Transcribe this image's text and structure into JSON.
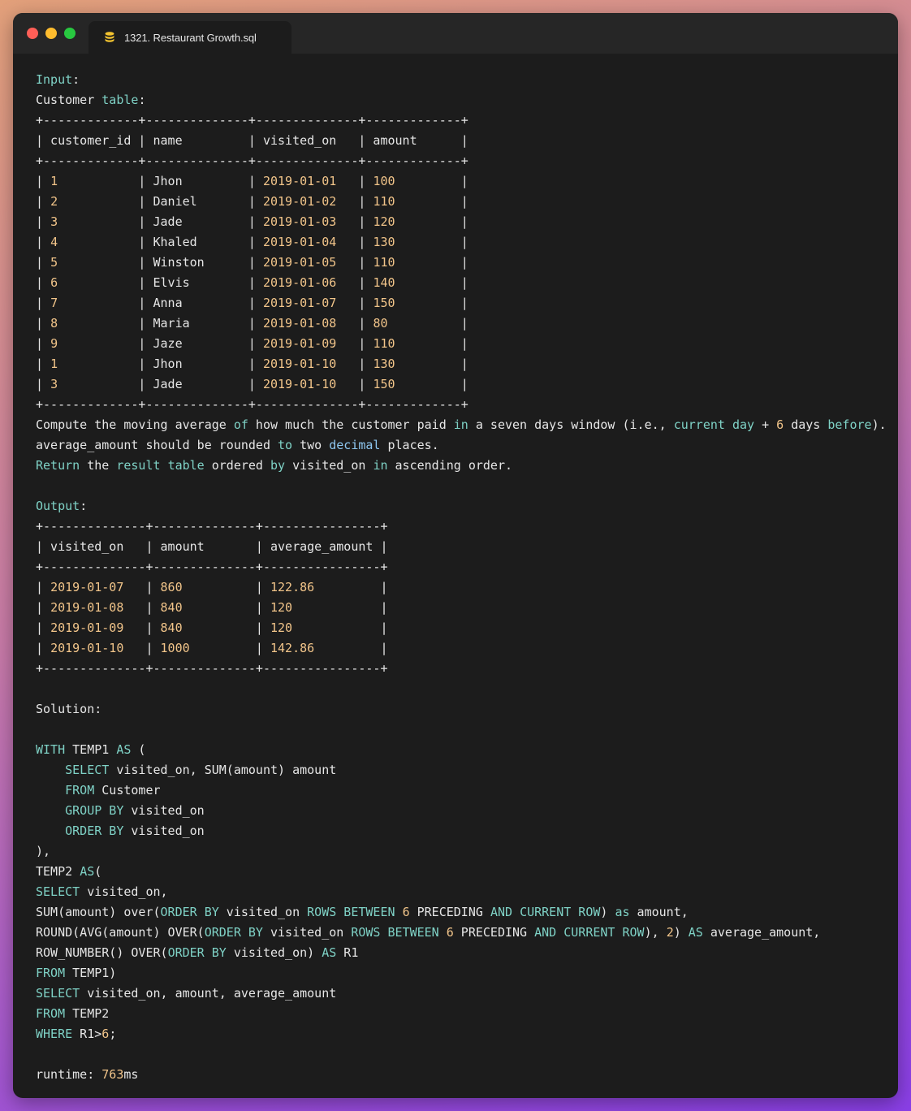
{
  "window": {
    "tab_title": "1321. Restaurant Growth.sql",
    "tab_icon": "database-icon",
    "colors": {
      "keyword": "#7fd2c6",
      "number": "#f2c58a",
      "text": "#e6e6e6",
      "background": "#1c1c1c"
    }
  },
  "editor": {
    "lines": [
      [
        {
          "t": "Input",
          "c": "kw"
        },
        {
          "t": ":"
        }
      ],
      [
        {
          "t": "Customer "
        },
        {
          "t": "table",
          "c": "kw"
        },
        {
          "t": ":"
        }
      ],
      [
        {
          "t": "+-------------+--------------+--------------+-------------+"
        }
      ],
      [
        {
          "t": "| customer_id | name         | visited_on   | amount      |"
        }
      ],
      [
        {
          "t": "+-------------+--------------+--------------+-------------+"
        }
      ],
      [
        {
          "t": "| "
        },
        {
          "t": "1",
          "c": "num"
        },
        {
          "t": "           | Jhon         | "
        },
        {
          "t": "2019-01-01",
          "c": "num"
        },
        {
          "t": "   | "
        },
        {
          "t": "100",
          "c": "num"
        },
        {
          "t": "         |"
        }
      ],
      [
        {
          "t": "| "
        },
        {
          "t": "2",
          "c": "num"
        },
        {
          "t": "           | Daniel       | "
        },
        {
          "t": "2019-01-02",
          "c": "num"
        },
        {
          "t": "   | "
        },
        {
          "t": "110",
          "c": "num"
        },
        {
          "t": "         |"
        }
      ],
      [
        {
          "t": "| "
        },
        {
          "t": "3",
          "c": "num"
        },
        {
          "t": "           | Jade         | "
        },
        {
          "t": "2019-01-03",
          "c": "num"
        },
        {
          "t": "   | "
        },
        {
          "t": "120",
          "c": "num"
        },
        {
          "t": "         |"
        }
      ],
      [
        {
          "t": "| "
        },
        {
          "t": "4",
          "c": "num"
        },
        {
          "t": "           | Khaled       | "
        },
        {
          "t": "2019-01-04",
          "c": "num"
        },
        {
          "t": "   | "
        },
        {
          "t": "130",
          "c": "num"
        },
        {
          "t": "         |"
        }
      ],
      [
        {
          "t": "| "
        },
        {
          "t": "5",
          "c": "num"
        },
        {
          "t": "           | Winston      | "
        },
        {
          "t": "2019-01-05",
          "c": "num"
        },
        {
          "t": "   | "
        },
        {
          "t": "110",
          "c": "num"
        },
        {
          "t": "         |"
        }
      ],
      [
        {
          "t": "| "
        },
        {
          "t": "6",
          "c": "num"
        },
        {
          "t": "           | Elvis        | "
        },
        {
          "t": "2019-01-06",
          "c": "num"
        },
        {
          "t": "   | "
        },
        {
          "t": "140",
          "c": "num"
        },
        {
          "t": "         |"
        }
      ],
      [
        {
          "t": "| "
        },
        {
          "t": "7",
          "c": "num"
        },
        {
          "t": "           | Anna         | "
        },
        {
          "t": "2019-01-07",
          "c": "num"
        },
        {
          "t": "   | "
        },
        {
          "t": "150",
          "c": "num"
        },
        {
          "t": "         |"
        }
      ],
      [
        {
          "t": "| "
        },
        {
          "t": "8",
          "c": "num"
        },
        {
          "t": "           | Maria        | "
        },
        {
          "t": "2019-01-08",
          "c": "num"
        },
        {
          "t": "   | "
        },
        {
          "t": "80",
          "c": "num"
        },
        {
          "t": "          |"
        }
      ],
      [
        {
          "t": "| "
        },
        {
          "t": "9",
          "c": "num"
        },
        {
          "t": "           | Jaze         | "
        },
        {
          "t": "2019-01-09",
          "c": "num"
        },
        {
          "t": "   | "
        },
        {
          "t": "110",
          "c": "num"
        },
        {
          "t": "         |"
        }
      ],
      [
        {
          "t": "| "
        },
        {
          "t": "1",
          "c": "num"
        },
        {
          "t": "           | Jhon         | "
        },
        {
          "t": "2019-01-10",
          "c": "num"
        },
        {
          "t": "   | "
        },
        {
          "t": "130",
          "c": "num"
        },
        {
          "t": "         |"
        }
      ],
      [
        {
          "t": "| "
        },
        {
          "t": "3",
          "c": "num"
        },
        {
          "t": "           | Jade         | "
        },
        {
          "t": "2019-01-10",
          "c": "num"
        },
        {
          "t": "   | "
        },
        {
          "t": "150",
          "c": "num"
        },
        {
          "t": "         |"
        }
      ],
      [
        {
          "t": "+-------------+--------------+--------------+-------------+"
        }
      ],
      [
        {
          "t": "Compute the moving average "
        },
        {
          "t": "of",
          "c": "kw"
        },
        {
          "t": " how much the customer paid "
        },
        {
          "t": "in",
          "c": "kw"
        },
        {
          "t": " a seven days window (i.e., "
        },
        {
          "t": "current",
          "c": "kw"
        },
        {
          "t": " "
        },
        {
          "t": "day",
          "c": "kw"
        },
        {
          "t": " + "
        },
        {
          "t": "6",
          "c": "num"
        },
        {
          "t": " days "
        },
        {
          "t": "before",
          "c": "kw"
        },
        {
          "t": ")."
        }
      ],
      [
        {
          "t": "average_amount should be rounded "
        },
        {
          "t": "to",
          "c": "kw"
        },
        {
          "t": " two "
        },
        {
          "t": "decimal",
          "c": "blue"
        },
        {
          "t": " places."
        }
      ],
      [
        {
          "t": "Return",
          "c": "kw"
        },
        {
          "t": " the "
        },
        {
          "t": "result",
          "c": "kw"
        },
        {
          "t": " "
        },
        {
          "t": "table",
          "c": "kw"
        },
        {
          "t": " ordered "
        },
        {
          "t": "by",
          "c": "kw"
        },
        {
          "t": " visited_on "
        },
        {
          "t": "in",
          "c": "kw"
        },
        {
          "t": " ascending order."
        }
      ],
      [],
      [
        {
          "t": "Output",
          "c": "kw"
        },
        {
          "t": ":"
        }
      ],
      [
        {
          "t": "+--------------+--------------+----------------+"
        }
      ],
      [
        {
          "t": "| visited_on   | amount       | average_amount |"
        }
      ],
      [
        {
          "t": "+--------------+--------------+----------------+"
        }
      ],
      [
        {
          "t": "| "
        },
        {
          "t": "2019-01-07",
          "c": "num"
        },
        {
          "t": "   | "
        },
        {
          "t": "860",
          "c": "num"
        },
        {
          "t": "          | "
        },
        {
          "t": "122.86",
          "c": "num"
        },
        {
          "t": "         |"
        }
      ],
      [
        {
          "t": "| "
        },
        {
          "t": "2019-01-08",
          "c": "num"
        },
        {
          "t": "   | "
        },
        {
          "t": "840",
          "c": "num"
        },
        {
          "t": "          | "
        },
        {
          "t": "120",
          "c": "num"
        },
        {
          "t": "            |"
        }
      ],
      [
        {
          "t": "| "
        },
        {
          "t": "2019-01-09",
          "c": "num"
        },
        {
          "t": "   | "
        },
        {
          "t": "840",
          "c": "num"
        },
        {
          "t": "          | "
        },
        {
          "t": "120",
          "c": "num"
        },
        {
          "t": "            |"
        }
      ],
      [
        {
          "t": "| "
        },
        {
          "t": "2019-01-10",
          "c": "num"
        },
        {
          "t": "   | "
        },
        {
          "t": "1000",
          "c": "num"
        },
        {
          "t": "         | "
        },
        {
          "t": "142.86",
          "c": "num"
        },
        {
          "t": "         |"
        }
      ],
      [
        {
          "t": "+--------------+--------------+----------------+"
        }
      ],
      [],
      [
        {
          "t": "Solution:"
        }
      ],
      [],
      [
        {
          "t": "WITH",
          "c": "kw"
        },
        {
          "t": " TEMP1 "
        },
        {
          "t": "AS",
          "c": "kw"
        },
        {
          "t": " ("
        }
      ],
      [
        {
          "t": "    "
        },
        {
          "t": "SELECT",
          "c": "kw"
        },
        {
          "t": " visited_on, SUM(amount) amount"
        }
      ],
      [
        {
          "t": "    "
        },
        {
          "t": "FROM",
          "c": "kw"
        },
        {
          "t": " Customer"
        }
      ],
      [
        {
          "t": "    "
        },
        {
          "t": "GROUP BY",
          "c": "kw"
        },
        {
          "t": " visited_on"
        }
      ],
      [
        {
          "t": "    "
        },
        {
          "t": "ORDER BY",
          "c": "kw"
        },
        {
          "t": " visited_on"
        }
      ],
      [
        {
          "t": "),"
        }
      ],
      [
        {
          "t": "TEMP2 "
        },
        {
          "t": "AS",
          "c": "kw"
        },
        {
          "t": "("
        }
      ],
      [
        {
          "t": "SELECT",
          "c": "kw"
        },
        {
          "t": " visited_on,"
        }
      ],
      [
        {
          "t": "SUM(amount) over("
        },
        {
          "t": "ORDER BY",
          "c": "kw"
        },
        {
          "t": " visited_on "
        },
        {
          "t": "ROWS BETWEEN",
          "c": "kw"
        },
        {
          "t": " "
        },
        {
          "t": "6",
          "c": "num"
        },
        {
          "t": " PRECEDING "
        },
        {
          "t": "AND",
          "c": "kw"
        },
        {
          "t": " "
        },
        {
          "t": "CURRENT ROW",
          "c": "kw"
        },
        {
          "t": ") "
        },
        {
          "t": "as",
          "c": "kw"
        },
        {
          "t": " amount,"
        }
      ],
      [
        {
          "t": "ROUND(AVG(amount) OVER("
        },
        {
          "t": "ORDER BY",
          "c": "kw"
        },
        {
          "t": " visited_on "
        },
        {
          "t": "ROWS BETWEEN",
          "c": "kw"
        },
        {
          "t": " "
        },
        {
          "t": "6",
          "c": "num"
        },
        {
          "t": " PRECEDING "
        },
        {
          "t": "AND",
          "c": "kw"
        },
        {
          "t": " "
        },
        {
          "t": "CURRENT ROW",
          "c": "kw"
        },
        {
          "t": "), "
        },
        {
          "t": "2",
          "c": "num"
        },
        {
          "t": ") "
        },
        {
          "t": "AS",
          "c": "kw"
        },
        {
          "t": " average_amount,"
        }
      ],
      [
        {
          "t": "ROW_NUMBER() OVER("
        },
        {
          "t": "ORDER BY",
          "c": "kw"
        },
        {
          "t": " visited_on) "
        },
        {
          "t": "AS",
          "c": "kw"
        },
        {
          "t": " R1"
        }
      ],
      [
        {
          "t": "FROM",
          "c": "kw"
        },
        {
          "t": " TEMP1)"
        }
      ],
      [
        {
          "t": "SELECT",
          "c": "kw"
        },
        {
          "t": " visited_on, amount, average_amount"
        }
      ],
      [
        {
          "t": "FROM",
          "c": "kw"
        },
        {
          "t": " TEMP2"
        }
      ],
      [
        {
          "t": "WHERE",
          "c": "kw"
        },
        {
          "t": " R1>"
        },
        {
          "t": "6",
          "c": "num"
        },
        {
          "t": ";"
        }
      ],
      [],
      [
        {
          "t": "runtime: "
        },
        {
          "t": "763",
          "c": "num"
        },
        {
          "t": "ms"
        }
      ]
    ]
  }
}
